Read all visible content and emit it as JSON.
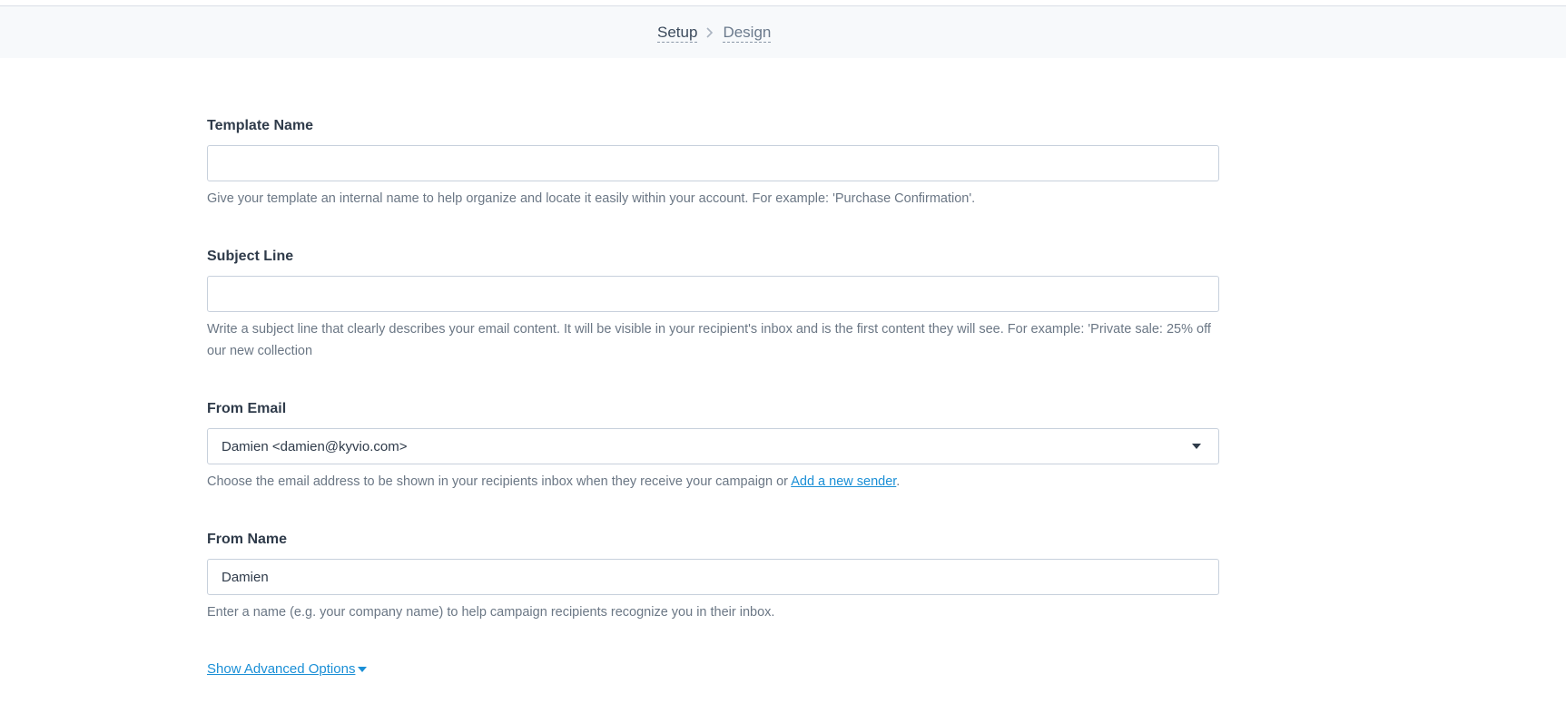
{
  "steps": [
    {
      "label": "Setup",
      "active": true
    },
    {
      "label": "Design",
      "active": false
    }
  ],
  "form": {
    "template_name": {
      "label": "Template Name",
      "value": "",
      "help": "Give your template an internal name to help organize and locate it easily within your account. For example: 'Purchase Confirmation'."
    },
    "subject_line": {
      "label": "Subject Line",
      "value": "",
      "help": "Write a subject line that clearly describes your email content. It will be visible in your recipient's inbox and is the first content they will see. For example: 'Private sale: 25% off our new collection"
    },
    "from_email": {
      "label": "From Email",
      "selected": "Damien <damien@kyvio.com>",
      "help_prefix": "Choose the email address to be shown in your recipients inbox when they receive your campaign or ",
      "help_link": "Add a new sender",
      "help_suffix": "."
    },
    "from_name": {
      "label": "From Name",
      "value": "Damien",
      "help": "Enter a name (e.g. your company name) to help campaign recipients recognize you in their inbox."
    },
    "advanced_options_link": "Show Advanced Options"
  },
  "colors": {
    "link": "#1a8fd6",
    "step_bar_bg": "#f7f9fb",
    "input_border": "#c7d0dc"
  }
}
